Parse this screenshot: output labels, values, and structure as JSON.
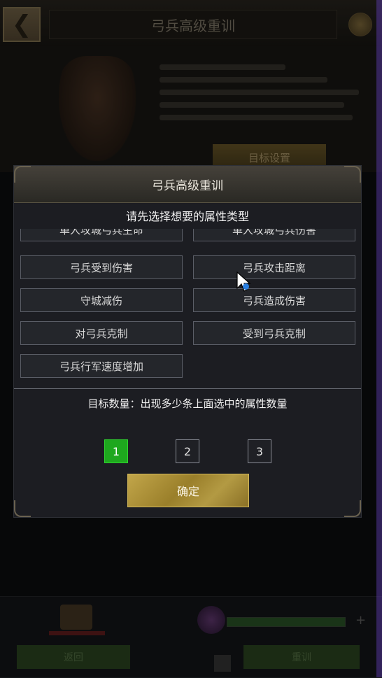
{
  "background": {
    "top_title": "弓兵高级重训",
    "hero_button": "目标设置",
    "bottom_left_button": "返回",
    "bottom_right_button": "重训"
  },
  "dialog": {
    "title": "弓兵高级重训",
    "subtitle": "请先选择想要的属性类型",
    "options": [
      "单人攻城弓兵生命",
      "单人攻城弓兵伤害",
      "弓兵受到伤害",
      "弓兵攻击距离",
      "守城减伤",
      "弓兵造成伤害",
      "对弓兵克制",
      "受到弓兵克制",
      "弓兵行军速度增加"
    ],
    "target_label": "目标数量：出现多少条上面选中的属性数量",
    "counts": [
      "1",
      "2",
      "3"
    ],
    "selected_count": "1",
    "confirm_label": "确定"
  },
  "colors": {
    "selected_green": "#1ea81e",
    "confirm_gold": "#b39a43",
    "dialog_bg": "#1c1d22"
  }
}
